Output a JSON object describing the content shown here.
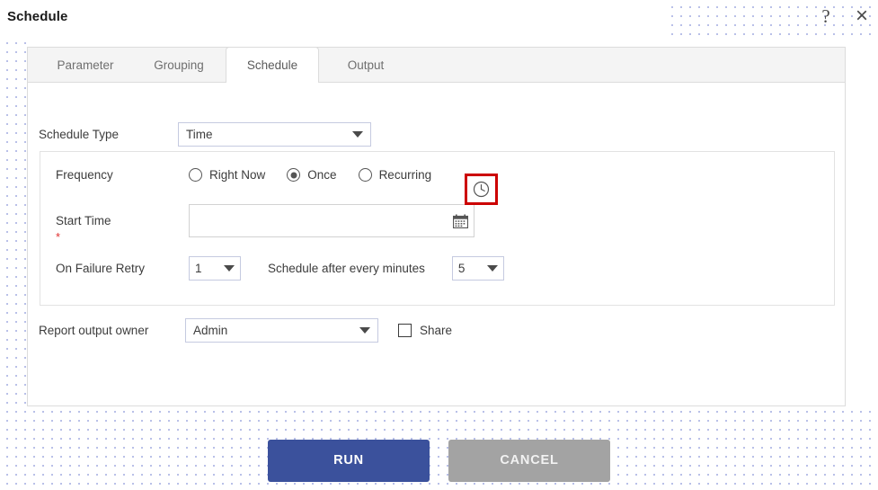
{
  "window": {
    "title": "Schedule",
    "help_icon": "question-mark-icon",
    "close_icon": "close-x-icon",
    "help_glyph": "?",
    "close_glyph": "×"
  },
  "tabs": [
    {
      "label": "Parameter",
      "active": false
    },
    {
      "label": "Grouping",
      "active": false
    },
    {
      "label": "Schedule",
      "active": true
    },
    {
      "label": "Output",
      "active": false
    }
  ],
  "form": {
    "schedule_type": {
      "label": "Schedule Type",
      "value": "Time"
    },
    "frequency": {
      "label": "Frequency",
      "options": [
        {
          "label": "Right Now",
          "selected": false
        },
        {
          "label": "Once",
          "selected": true
        },
        {
          "label": "Recurring",
          "selected": false
        }
      ]
    },
    "start_time": {
      "label": "Start Time",
      "required_marker": "*",
      "value": "",
      "placeholder": "",
      "calendar_icon": "calendar-icon",
      "clock_icon": "clock-icon",
      "clock_highlight_color": "#cc0000"
    },
    "retry": {
      "label": "On Failure Retry",
      "count_value": "1",
      "interval_label": "Schedule after every minutes",
      "minutes_value": "5"
    },
    "owner": {
      "label": "Report output owner",
      "value": "Admin",
      "share_label": "Share",
      "share_checked": false
    }
  },
  "footer": {
    "run_label": "RUN",
    "cancel_label": "CANCEL",
    "run_color": "#3b519c",
    "cancel_color": "#a3a3a3"
  }
}
